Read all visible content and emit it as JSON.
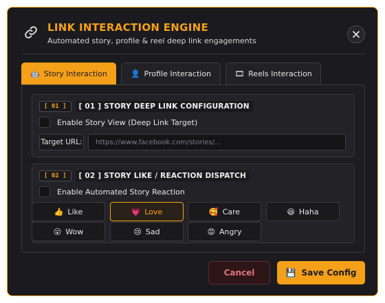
{
  "header": {
    "title": "LINK INTERACTION ENGINE",
    "subtitle": "Automated story, profile & reel deep link engagements",
    "icon": "link-icon",
    "close_label": "✕"
  },
  "tabs": [
    {
      "label": "Story Interaction",
      "icon": "🤖",
      "active": true
    },
    {
      "label": "Profile Interaction",
      "icon": "👤",
      "active": false
    },
    {
      "label": "Reels Interaction",
      "icon": "🎞",
      "active": false
    }
  ],
  "section1": {
    "number": "[ 01 ]",
    "title": "[ 01 ] STORY DEEP LINK CONFIGURATION",
    "checkbox_label": "Enable Story View (Deep Link Target)",
    "url_label": "Target URL:",
    "url_placeholder": "https://www.facebook.com/stories/...",
    "url_value": ""
  },
  "section2": {
    "number": "[ 02 ]",
    "title": "[ 02 ] STORY LIKE / REACTION DISPATCH",
    "checkbox_label": "Enable Automated Story Reaction",
    "reactions": [
      {
        "label": "Like",
        "emoji": "👍",
        "selected": false
      },
      {
        "label": "Love",
        "emoji": "💗",
        "selected": true
      },
      {
        "label": "Care",
        "emoji": "🥰",
        "selected": false
      },
      {
        "label": "Haha",
        "emoji": "😆",
        "selected": false
      },
      {
        "label": "Wow",
        "emoji": "😮",
        "selected": false
      },
      {
        "label": "Sad",
        "emoji": "😢",
        "selected": false
      },
      {
        "label": "Angry",
        "emoji": "😡",
        "selected": false
      }
    ]
  },
  "footer": {
    "cancel_label": "Cancel",
    "save_label": "Save Config",
    "save_icon": "💾"
  },
  "colors": {
    "accent": "#f5a019",
    "background": "#1b1b1f",
    "danger": "#e0737a"
  }
}
